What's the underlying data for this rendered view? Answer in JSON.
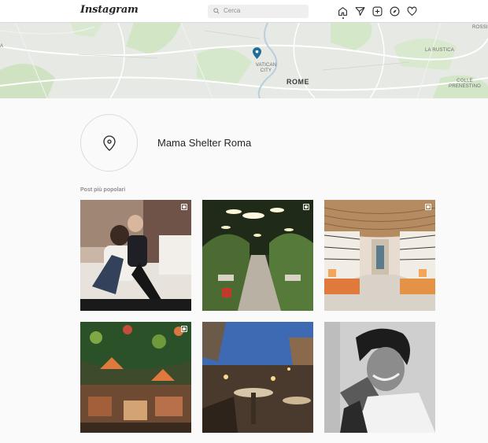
{
  "nav": {
    "logo": "Instagram",
    "search_placeholder": "Cerca",
    "icons": [
      "home-icon",
      "direct-icon",
      "new-post-icon",
      "explore-icon",
      "activity-icon"
    ]
  },
  "map": {
    "labels": {
      "vatican": "VATICAN CITY",
      "rome": "ROME",
      "la_rustica": "LA RUSTICA",
      "colle": "COLLE PRENESTINO",
      "colle_line1": "COLLE",
      "colle_line2": "PRENESTINO",
      "rossi": "ROSSI",
      "edge_left": "A"
    }
  },
  "location": {
    "name": "Mama Shelter Roma"
  },
  "posts": {
    "section_title": "Post più popolari",
    "items": [
      {
        "description": "couple sitting on bed",
        "multi": true
      },
      {
        "description": "garden terrace with lights",
        "multi": true
      },
      {
        "description": "patterned lounge corridor",
        "multi": true
      },
      {
        "description": "plants and lamps restaurant",
        "multi": true
      },
      {
        "description": "rooftop terrace at dusk",
        "multi": false
      },
      {
        "description": "black and white portrait",
        "multi": false
      }
    ]
  },
  "colors": {
    "accent_marker": "#1e6e96",
    "border": "#dbdbdb",
    "background": "#fafafa"
  }
}
